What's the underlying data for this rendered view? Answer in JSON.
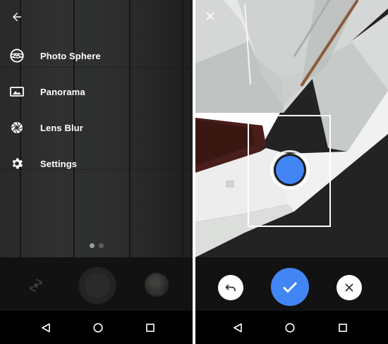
{
  "left_screen": {
    "back_icon": "arrow-back-icon",
    "menu": [
      {
        "label": "Photo Sphere",
        "icon": "photo-sphere-icon"
      },
      {
        "label": "Panorama",
        "icon": "panorama-icon"
      },
      {
        "label": "Lens Blur",
        "icon": "lens-blur-icon"
      },
      {
        "label": "Settings",
        "icon": "gear-icon"
      }
    ],
    "page_indicator": {
      "count": 2,
      "active_index": 0
    },
    "controls": {
      "switch_camera_icon": "switch-camera-icon",
      "shutter_icon": "shutter-icon",
      "gallery_thumbnail": "gallery-thumbnail"
    }
  },
  "right_screen": {
    "close_icon": "close-icon",
    "controls": {
      "undo_icon": "undo-icon",
      "confirm_icon": "check-icon",
      "cancel_icon": "close-icon"
    }
  },
  "navbar": {
    "back_icon": "nav-back-icon",
    "home_icon": "nav-home-icon",
    "recents_icon": "nav-recents-icon"
  },
  "colors": {
    "accent_blue": "#4285f4",
    "menu_text": "#ffffff",
    "controls_bg": "#121212",
    "navbar_bg": "#000000"
  }
}
